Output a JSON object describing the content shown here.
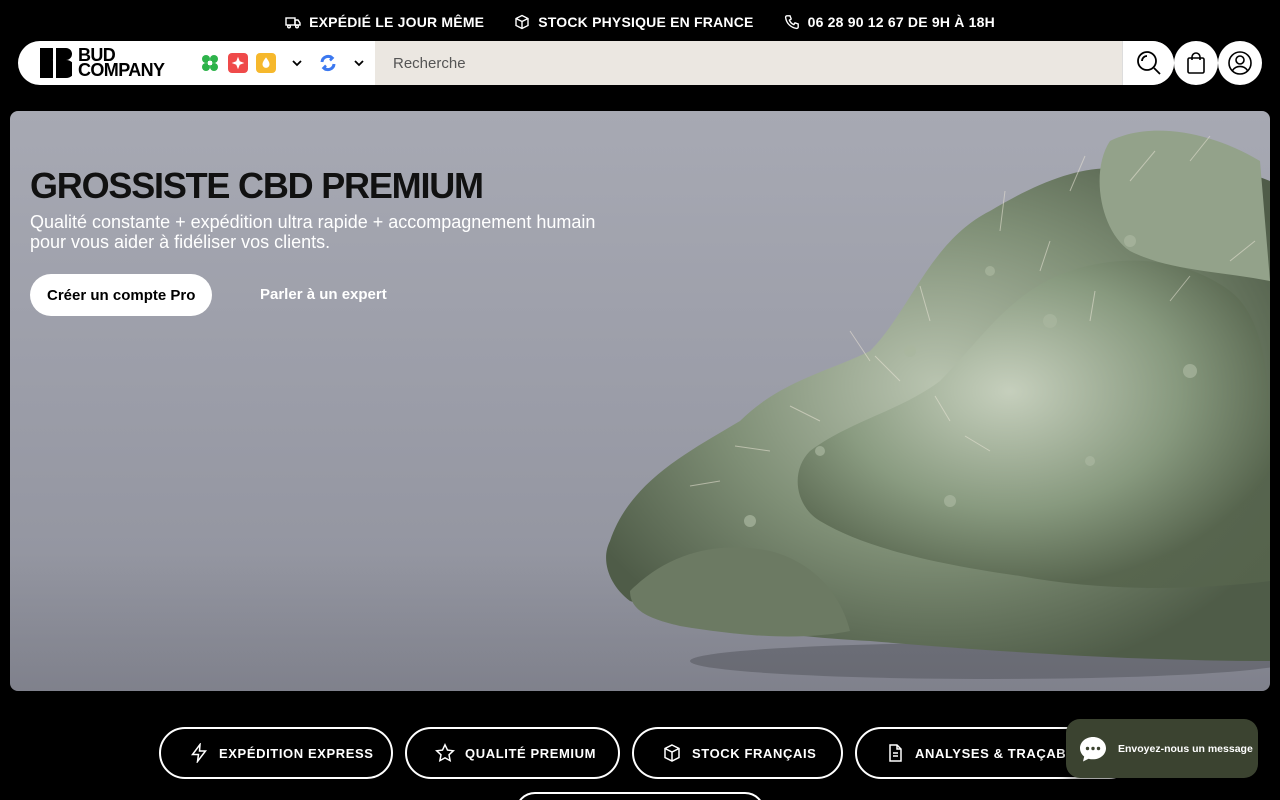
{
  "announcement": {
    "items": [
      {
        "icon": "truck-icon",
        "label": "EXPÉDIÉ LE JOUR MÊME"
      },
      {
        "icon": "box-icon",
        "label": "STOCK PHYSIQUE EN FRANCE"
      },
      {
        "icon": "phone-icon",
        "label": "06 28 90 12 67 DE 9H À 18H"
      }
    ]
  },
  "header": {
    "logo_line1": "BUD",
    "logo_line2": "COMPANY",
    "search_placeholder": "Recherche"
  },
  "hero": {
    "title": "GROSSISTE CBD PREMIUM",
    "subtitle": "Qualité constante + expédition ultra rapide + accompagnement humain pour vous aider à fidéliser vos clients.",
    "cta_label": "Créer un compte Pro",
    "link_label": "Parler à un expert"
  },
  "features": [
    {
      "icon": "lightning-icon",
      "label": "EXPÉDITION EXPRESS"
    },
    {
      "icon": "star-icon",
      "label": "QUALITÉ PREMIUM"
    },
    {
      "icon": "box-icon",
      "label": "STOCK FRANÇAIS"
    },
    {
      "icon": "document-icon",
      "label": "ANALYSES & TRAÇABILITÉ"
    }
  ],
  "chat": {
    "label": "Envoyez-nous un message"
  },
  "colors": {
    "background": "#000000",
    "search_bg": "#ebe7e1",
    "chat_bg": "#3b4330",
    "hero_bg": "#9c9ea9"
  }
}
